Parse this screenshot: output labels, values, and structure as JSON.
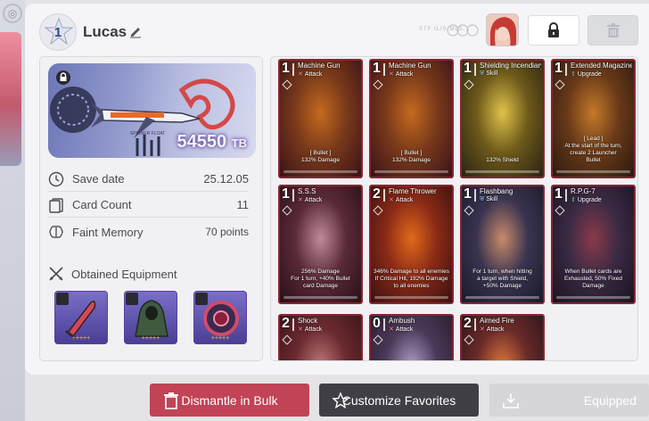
{
  "header": {
    "level": "1",
    "player_name": "Lucas",
    "watermark": "STF ILIS MLS."
  },
  "banner": {
    "score": "54550",
    "score_unit": "TB",
    "ship_text": "SPINNER FLOAT"
  },
  "stats": [
    {
      "label": "Save date",
      "value": "25.12.05",
      "icon": "clock-icon"
    },
    {
      "label": "Card Count",
      "value": "11",
      "icon": "card-stack-icon"
    },
    {
      "label": "Faint Memory",
      "value": "70 points",
      "icon": "brain-icon"
    }
  ],
  "equipment": {
    "title": "Obtained Equipment",
    "items": [
      {
        "name": "blade",
        "stars": "+++++"
      },
      {
        "name": "cloak",
        "stars": "+++++"
      },
      {
        "name": "device",
        "stars": "+++++"
      }
    ]
  },
  "cards": [
    {
      "cost": "1",
      "name": "Machine Gun",
      "type": "Attack",
      "desc": "[ Bullet ]\n132% Damage",
      "kind": "attack"
    },
    {
      "cost": "1",
      "name": "Machine Gun",
      "type": "Attack",
      "desc": "[ Bullet ]\n132% Damage",
      "kind": "attack"
    },
    {
      "cost": "1",
      "name": "Shielding Incendiary Bomb",
      "type": "Skill",
      "desc": "132% Shield",
      "kind": "skill"
    },
    {
      "cost": "1",
      "name": "Extended Magazine",
      "type": "Upgrade",
      "desc": "[ Lead ]\nAt the start of the turn,\ncreate 2 Launcher\nBullet",
      "kind": "upgrade"
    },
    {
      "cost": "1",
      "name": "S.S.S",
      "type": "Attack",
      "desc": "256% Damage\nFor 1 turn, +40% Bullet\ncard Damage",
      "kind": "attack"
    },
    {
      "cost": "2",
      "name": "Flame Thrower",
      "type": "Attack",
      "desc": "346% Damage to all enemies\nIf Critical Hit, 192% Damage\nto all enemies",
      "kind": "attack"
    },
    {
      "cost": "1",
      "name": "Flashbang",
      "type": "Skill",
      "desc": "For 1 turn, when hitting\na target with Shield,\n+50% Damage",
      "kind": "skill"
    },
    {
      "cost": "1",
      "name": "R.P.G-7",
      "type": "Upgrade",
      "desc": "When Bullet cards are\nExhausted, 50% Fixed\nDamage",
      "kind": "upgrade"
    },
    {
      "cost": "2",
      "name": "Shock",
      "type": "Attack",
      "desc": "",
      "kind": "attack"
    },
    {
      "cost": "0",
      "name": "Ambush",
      "type": "Attack",
      "desc": "",
      "kind": "attack"
    },
    {
      "cost": "2",
      "name": "Aimed Fire",
      "type": "Attack",
      "desc": "",
      "kind": "attack"
    }
  ],
  "buttons": {
    "dismantle": "Dismantle in Bulk",
    "favorites": "Customize Favorites",
    "equipped": "Equipped"
  },
  "colors": {
    "dismantle": "#c04456",
    "favorites": "#3f3f45",
    "equipped": "#d6d6da",
    "card_border": "#8a2434"
  }
}
